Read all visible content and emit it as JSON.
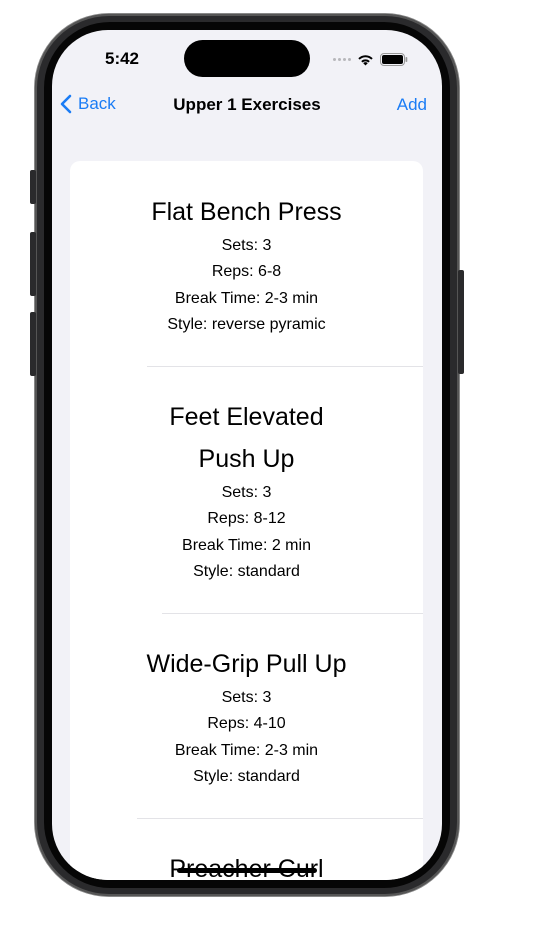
{
  "status_bar": {
    "time": "5:42"
  },
  "nav": {
    "back_label": "Back",
    "title": "Upper 1 Exercises",
    "add_label": "Add"
  },
  "exercises": [
    {
      "name_lines": [
        "Flat Bench Press"
      ],
      "sets": "Sets: 3",
      "reps": "Reps: 6-8",
      "break_time": "Break Time: 2-3 min",
      "style": "Style: reverse pyramic"
    },
    {
      "name_lines": [
        "Feet Elevated",
        "Push Up"
      ],
      "sets": "Sets: 3",
      "reps": "Reps: 8-12",
      "break_time": "Break Time: 2 min",
      "style": "Style: standard"
    },
    {
      "name_lines": [
        "Wide-Grip Pull Up"
      ],
      "sets": "Sets: 3",
      "reps": "Reps: 4-10",
      "break_time": "Break Time: 2-3 min",
      "style": "Style: standard"
    },
    {
      "name_lines": [
        "Preacher Curl"
      ]
    }
  ],
  "colors": {
    "accent": "#1a7cf5",
    "background": "#f2f2f7",
    "card": "#ffffff",
    "separator": "#e3e3e7"
  }
}
